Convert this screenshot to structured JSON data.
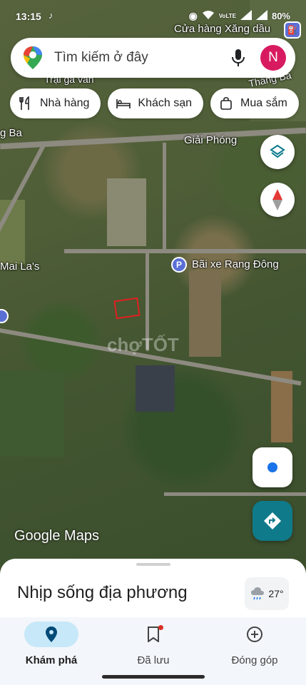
{
  "status_bar": {
    "time": "13:15",
    "app_icon": "tiktok-icon",
    "network": "VoLTE",
    "battery": "80%"
  },
  "search": {
    "placeholder": "Tìm kiếm ở đây",
    "avatar_initial": "N"
  },
  "chips": [
    {
      "label": "Nhà hàng",
      "icon": "restaurant-icon"
    },
    {
      "label": "Khách sạn",
      "icon": "hotel-icon"
    },
    {
      "label": "Mua sắm",
      "icon": "shopping-bag-icon"
    }
  ],
  "map": {
    "labels": {
      "gas_station": "Cửa hàng Xăng dầu",
      "farm": "Trại gà vân",
      "thang_ba": "Tháng Ba",
      "g_ba": "g Ba",
      "giai_phong": "Giải Phóng",
      "mai_las": "Mai La's",
      "parking": "Bãi xe Rạng Đông"
    },
    "watermark": "chợTỐT",
    "logo_text": "Google Maps",
    "colors": {
      "marker": "#e02020",
      "parking_pin": "#5a6fd6",
      "directions": "#0f7a8a"
    }
  },
  "sheet": {
    "title": "Nhịp sống địa phương",
    "temperature": "27°"
  },
  "bottom_nav": {
    "items": [
      {
        "label": "Khám phá",
        "icon": "explore-pin-icon",
        "active": true
      },
      {
        "label": "Đã lưu",
        "icon": "bookmark-icon",
        "active": false
      },
      {
        "label": "Đóng góp",
        "icon": "add-circle-icon",
        "active": false
      }
    ]
  }
}
